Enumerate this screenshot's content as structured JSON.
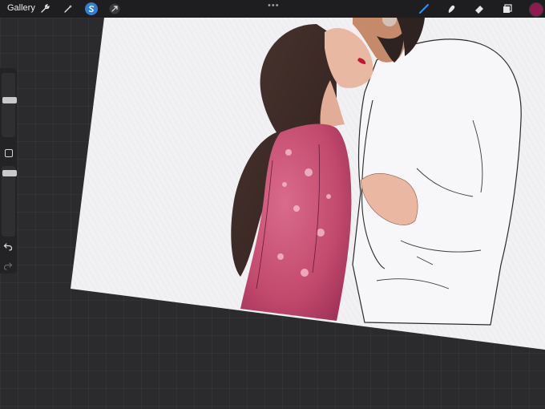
{
  "toolbar": {
    "gallery_label": "Gallery",
    "left_tools": [
      "wrench-icon",
      "magic-wand-icon",
      "selection-icon",
      "transform-arrow-icon"
    ],
    "center_menu": "•••",
    "right_tools": [
      "brush-icon",
      "smudge-icon",
      "eraser-icon",
      "layers-icon"
    ],
    "active_tool": "brush",
    "active_color": "#8d1b4f",
    "accent_color": "#2f7fd8"
  },
  "sidebar": {
    "brush_size_level": 0.42,
    "opacity_level": 0.06
  },
  "artwork": {
    "subject": "watercolor-couple-illustration"
  }
}
